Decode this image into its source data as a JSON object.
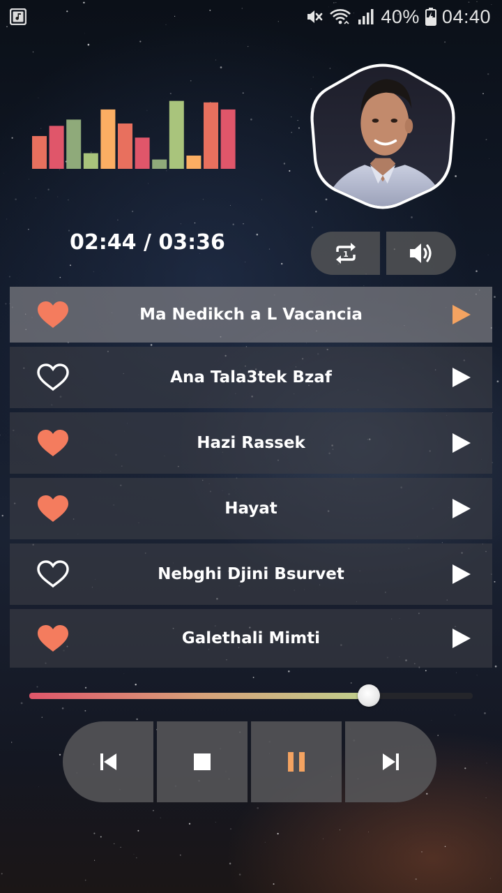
{
  "status_bar": {
    "app_icon": "music-note-icon",
    "icons": [
      "mute-icon",
      "wifi-icon",
      "signal-icon"
    ],
    "battery_percent": "40%",
    "battery_icon": "battery-charging-icon",
    "time": "04:40"
  },
  "equalizer": {
    "levels": [
      0.42,
      0.55,
      0.63,
      0.2,
      0.76,
      0.58,
      0.4,
      0.12,
      0.87,
      0.17,
      0.85,
      0.76
    ],
    "colors": [
      "#e8705e",
      "#e0566a",
      "#8faa7a",
      "#a9c47c",
      "#fbae63",
      "#e8705e",
      "#e0566a",
      "#8faa7a",
      "#a9c47c",
      "#fbae63",
      "#e8705e",
      "#e0566a"
    ]
  },
  "player": {
    "time_display": "02:44 / 03:36",
    "progress": 0.766,
    "repeat_icon": "repeat-one-icon",
    "volume_icon": "volume-icon"
  },
  "playlist": [
    {
      "title": "Ma Nedikch a L Vacancia",
      "favorite": true,
      "active": true
    },
    {
      "title": "Ana Tala3tek Bzaf",
      "favorite": false,
      "active": false
    },
    {
      "title": "Hazi Rassek",
      "favorite": true,
      "active": false
    },
    {
      "title": "Hayat",
      "favorite": true,
      "active": false
    },
    {
      "title": "Nebghi Djini Bsurvet",
      "favorite": false,
      "active": false
    },
    {
      "title": "Galethali Mimti",
      "favorite": true,
      "active": false
    }
  ],
  "transport": {
    "icons": [
      "previous-icon",
      "stop-icon",
      "pause-icon",
      "next-icon"
    ]
  },
  "colors": {
    "accent": "#f47c5e",
    "play_active": "#f4a361",
    "pause": "#f4a361",
    "button_bg": "#58585a"
  }
}
